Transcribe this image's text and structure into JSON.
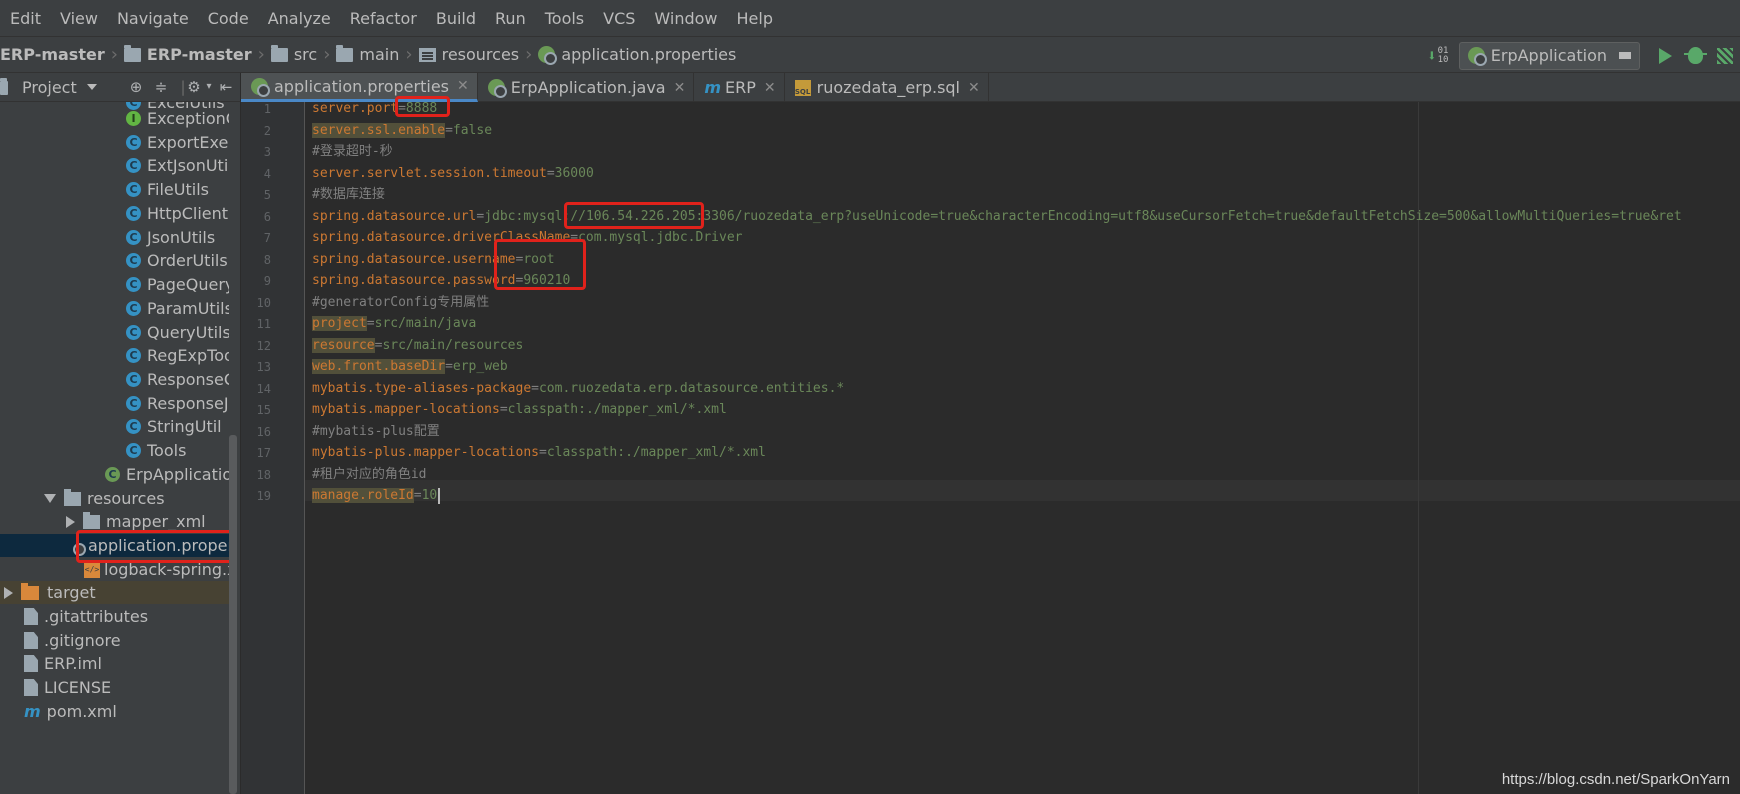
{
  "menu": [
    "Edit",
    "View",
    "Navigate",
    "Code",
    "Analyze",
    "Refactor",
    "Build",
    "Run",
    "Tools",
    "VCS",
    "Window",
    "Help"
  ],
  "breadcrumb": [
    "ERP-master",
    "ERP-master",
    "src",
    "main",
    "resources",
    "application.properties"
  ],
  "run_config": "ErpApplication",
  "project_panel": {
    "title": "Project",
    "tree": [
      {
        "label": "ExcelUtils",
        "icon": "class-icon"
      },
      {
        "label": "ExceptionCode",
        "icon": "interface-icon"
      },
      {
        "label": "ExportExecUtil",
        "icon": "class-icon"
      },
      {
        "label": "ExtJsonUtils",
        "icon": "class-icon"
      },
      {
        "label": "FileUtils",
        "icon": "class-icon"
      },
      {
        "label": "HttpClient",
        "icon": "class-icon"
      },
      {
        "label": "JsonUtils",
        "icon": "class-icon"
      },
      {
        "label": "OrderUtils",
        "icon": "class-icon"
      },
      {
        "label": "PageQueryInfo",
        "icon": "class-icon"
      },
      {
        "label": "ParamUtils",
        "icon": "class-icon"
      },
      {
        "label": "QueryUtils",
        "icon": "class-icon"
      },
      {
        "label": "RegExpTools",
        "icon": "class-icon"
      },
      {
        "label": "ResponseCode",
        "icon": "class-icon"
      },
      {
        "label": "ResponseJson",
        "icon": "class-icon"
      },
      {
        "label": "StringUtil",
        "icon": "class-icon"
      },
      {
        "label": "Tools",
        "icon": "class-icon"
      },
      {
        "label": "ErpApplication",
        "icon": "spring-class-icon"
      },
      {
        "label": "resources",
        "icon": "resources-folder-icon"
      },
      {
        "label": "mapper_xml",
        "icon": "folder-icon"
      },
      {
        "label": "application.properties",
        "icon": "spring-properties-icon"
      },
      {
        "label": "logback-spring.xml",
        "icon": "xml-icon"
      },
      {
        "label": "target",
        "icon": "folder-icon"
      },
      {
        "label": ".gitattributes",
        "icon": "file-icon"
      },
      {
        "label": ".gitignore",
        "icon": "file-icon"
      },
      {
        "label": "ERP.iml",
        "icon": "file-icon"
      },
      {
        "label": "LICENSE",
        "icon": "file-icon"
      },
      {
        "label": "pom.xml",
        "icon": "maven-icon"
      }
    ]
  },
  "tabs": [
    {
      "label": "application.properties",
      "active": true
    },
    {
      "label": "ErpApplication.java",
      "active": false
    },
    {
      "label": "ERP",
      "active": false
    },
    {
      "label": "ruozedata_erp.sql",
      "active": false
    }
  ],
  "editor": {
    "lines": [
      {
        "num": "1",
        "key": "server.port",
        "value": "8888",
        "comment": ""
      },
      {
        "num": "2",
        "key": "server.ssl.enable",
        "value": "false",
        "comment": ""
      },
      {
        "num": "3",
        "key": "",
        "value": "",
        "comment": "#登录超时-秒"
      },
      {
        "num": "4",
        "key": "server.servlet.session.timeout",
        "value": "36000",
        "comment": ""
      },
      {
        "num": "5",
        "key": "",
        "value": "",
        "comment": "#数据库连接"
      },
      {
        "num": "6",
        "key": "spring.datasource.url",
        "value": "jdbc:mysql://106.54.226.205:3306/ruozedata_erp?useUnicode=true&characterEncoding=utf8&useCursorFetch=true&defaultFetchSize=500&allowMultiQueries=true&ret",
        "comment": ""
      },
      {
        "num": "7",
        "key": "spring.datasource.driverClassName",
        "value": "com.mysql.jdbc.Driver",
        "comment": ""
      },
      {
        "num": "8",
        "key": "spring.datasource.username",
        "value": "root",
        "comment": ""
      },
      {
        "num": "9",
        "key": "spring.datasource.password",
        "value": "960210",
        "comment": ""
      },
      {
        "num": "10",
        "key": "",
        "value": "",
        "comment": "#generatorConfig专用属性"
      },
      {
        "num": "11",
        "key": "project",
        "value": "src/main/java",
        "comment": ""
      },
      {
        "num": "12",
        "key": "resource",
        "value": "src/main/resources",
        "comment": ""
      },
      {
        "num": "13",
        "key": "web.front.baseDir",
        "value": "erp_web",
        "comment": ""
      },
      {
        "num": "14",
        "key": "mybatis.type-aliases-package",
        "value": "com.ruozedata.erp.datasource.entities.*",
        "comment": ""
      },
      {
        "num": "15",
        "key": "mybatis.mapper-locations",
        "value": "classpath:./mapper_xml/*.xml",
        "comment": ""
      },
      {
        "num": "16",
        "key": "",
        "value": "",
        "comment": "#mybatis-plus配置"
      },
      {
        "num": "17",
        "key": "mybatis-plus.mapper-locations",
        "value": "classpath:./mapper_xml/*.xml",
        "comment": ""
      },
      {
        "num": "18",
        "key": "",
        "value": "",
        "comment": "#租户对应的角色id"
      },
      {
        "num": "19",
        "key": "manage.roleId",
        "value": "10",
        "comment": ""
      }
    ]
  },
  "watermark": "https://blog.csdn.net/SparkOnYarn",
  "colors": {
    "accent": "#4a88c7",
    "highlight_box": "#e0221b",
    "key": "#cc7832",
    "value": "#6a8759"
  }
}
